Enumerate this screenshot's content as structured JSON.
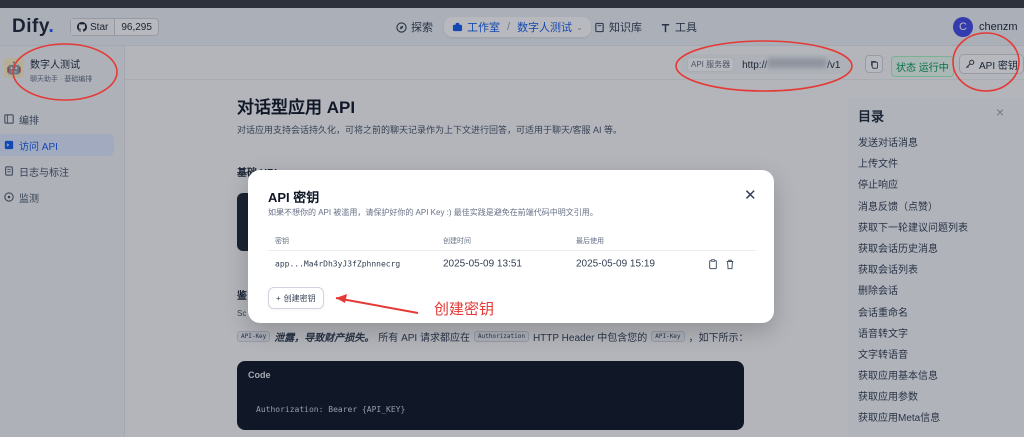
{
  "header": {
    "logo": "Dify",
    "github_star_label": "Star",
    "github_star_count": "96,295",
    "nav_explore": "探索",
    "nav_studio": "工作室",
    "nav_app": "数字人测试",
    "nav_knowledge": "知识库",
    "nav_tools": "工具",
    "user_initial": "C",
    "user_name": "chenzm"
  },
  "sidebar": {
    "app_name": "数字人测试",
    "app_sub": "聊天助手 · 基础编排",
    "items": [
      {
        "label": "编排"
      },
      {
        "label": "访问 API"
      },
      {
        "label": "日志与标注"
      },
      {
        "label": "监测"
      }
    ]
  },
  "toolbar": {
    "api_server_label": "API 服务器",
    "api_prefix": "http://",
    "api_suffix": "/v1",
    "status": "状态 运行中",
    "api_key_label": "API 密钥"
  },
  "doc": {
    "title": "对话型应用 API",
    "desc": "对话应用支持会话持久化，可将之前的聊天记录作为上下文进行回答，可适用于聊天/客服 AI 等。",
    "base_url_heading": "基础 URL",
    "auth_heading": "鉴",
    "auth_sc": "Sc",
    "auth_tag1": "API-Key",
    "auth_bold": "泄露，导致财产损失。",
    "auth_text1": "所有 API 请求都应在",
    "auth_tag2": "Authorization",
    "auth_text2": "HTTP Header 中包含您的",
    "auth_tag3": "API-Key",
    "auth_text3": "，如下所示：",
    "code_heading": "Code",
    "code_line": "Authorization: Bearer {API_KEY}"
  },
  "toc": {
    "title": "目录",
    "items": [
      "发送对话消息",
      "上传文件",
      "停止响应",
      "消息反馈（点赞）",
      "获取下一轮建议问题列表",
      "获取会话历史消息",
      "获取会话列表",
      "删除会话",
      "会话重命名",
      "语音转文字",
      "文字转语音",
      "获取应用基本信息",
      "获取应用参数",
      "获取应用Meta信息"
    ]
  },
  "modal": {
    "title": "API 密钥",
    "desc": "如果不想你的 API 被滥用，请保护好你的 API Key :) 最佳实践是避免在前端代码中明文引用。",
    "columns": [
      "密钥",
      "创建时间",
      "最后使用"
    ],
    "rows": [
      {
        "key": "app...Ma4rDh3yJ3fZphnnecrg",
        "created": "2025-05-09 13:51",
        "last_used": "2025-05-09 15:19"
      }
    ],
    "create_label": "创建密钥"
  },
  "annotation": {
    "text": "创建密钥",
    "color": "#e53935"
  },
  "colors": {
    "accent": "#155eef",
    "status_green": "#039855"
  }
}
